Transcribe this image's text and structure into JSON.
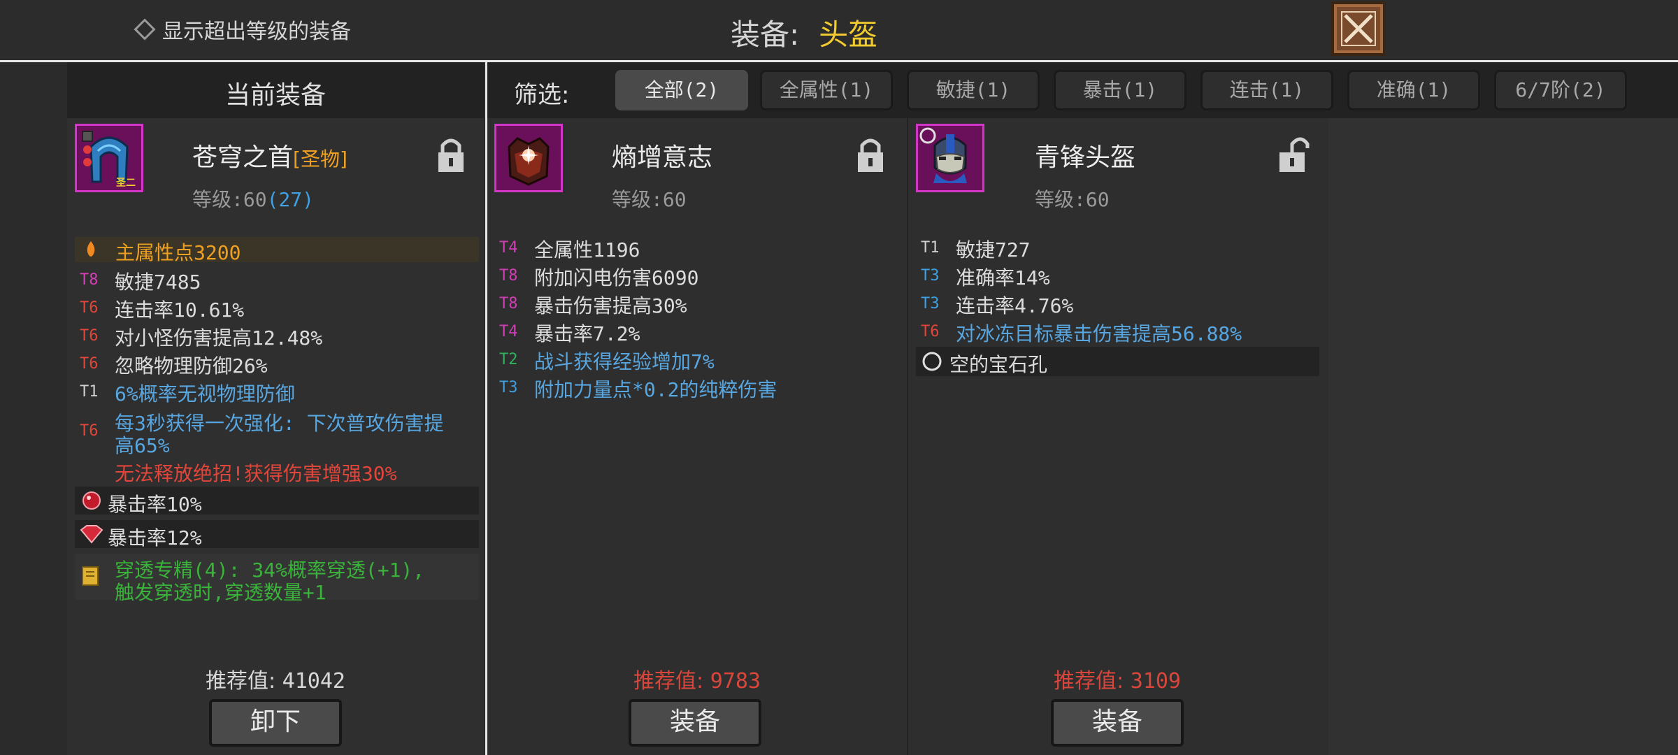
{
  "top": {
    "show_over_level_label": "显示超出等级的装备",
    "title_label": "装备:",
    "title_value": "头盔"
  },
  "left": {
    "header": "当前装备",
    "item": {
      "name": "苍穹之首",
      "tag": "[圣物]",
      "level_label": "等级:60",
      "level_extra": "(27)",
      "main_stat": "主属性点3200",
      "stats": [
        {
          "tier": "T8",
          "text": "敏捷7485"
        },
        {
          "tier": "T6",
          "text": "连击率10.61%"
        },
        {
          "tier": "T6",
          "text": "对小怪伤害提高12.48%"
        },
        {
          "tier": "T6",
          "text": "忽略物理防御26%"
        },
        {
          "tier": "T1",
          "text": "6%概率无视物理防御"
        },
        {
          "tier": "T6",
          "text": "每3秒获得一次强化: 下次普攻伤害提"
        },
        {
          "tier": "",
          "text": "高65%"
        },
        {
          "tier": "",
          "text": "无法释放绝招!获得伤害增强30%"
        }
      ],
      "gems": [
        "暴击率10%",
        "暴击率12%"
      ],
      "set_bonus_line1": "穿透专精(4): 34%概率穿透(+1),",
      "set_bonus_line2": "触发穿透时,穿透数量+1",
      "rec_label": "推荐值:",
      "rec_value": "41042",
      "button": "卸下"
    }
  },
  "filter": {
    "label": "筛选:",
    "tabs": [
      "全部(2)",
      "全属性(1)",
      "敏捷(1)",
      "暴击(1)",
      "连击(1)",
      "准确(1)",
      "6/7阶(2)"
    ]
  },
  "items": [
    {
      "name": "熵增意志",
      "level_label": "等级:60",
      "stats": [
        {
          "tier": "T4",
          "text": "全属性1196"
        },
        {
          "tier": "T8",
          "text": "附加闪电伤害6090"
        },
        {
          "tier": "T8",
          "text": "暴击伤害提高30%"
        },
        {
          "tier": "T4",
          "text": "暴击率7.2%"
        },
        {
          "tier": "T2",
          "text": "战斗获得经验增加7%"
        },
        {
          "tier": "T3",
          "text": "附加力量点*0.2的纯粹伤害"
        }
      ],
      "rec_label": "推荐值:",
      "rec_value": "9783",
      "button": "装备"
    },
    {
      "name": "青锋头盔",
      "level_label": "等级:60",
      "stats": [
        {
          "tier": "T1",
          "text": "敏捷727"
        },
        {
          "tier": "T3",
          "text": "准确率14%"
        },
        {
          "tier": "T3",
          "text": "连击率4.76%"
        },
        {
          "tier": "T6",
          "text": "对冰冻目标暴击伤害提高56.88%"
        }
      ],
      "socket": "空的宝石孔",
      "rec_label": "推荐值:",
      "rec_value": "3109",
      "button": "装备"
    }
  ],
  "colors": {
    "accent_gold": "#f2cc2e",
    "recommend_red": "#d8463c",
    "frame_magenta": "#d236c7"
  }
}
